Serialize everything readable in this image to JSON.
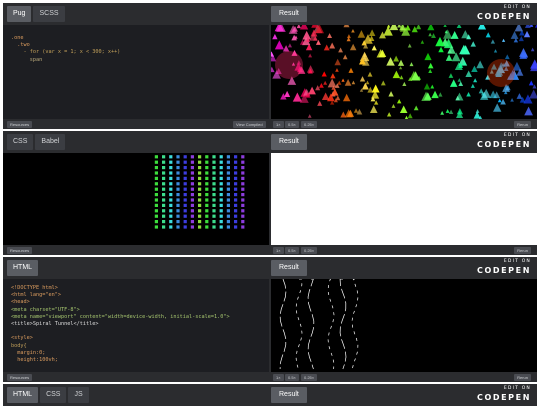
{
  "embeds": [
    {
      "left_tabs": [
        {
          "label": "Pug",
          "active": true
        },
        {
          "label": "SCSS",
          "active": false
        }
      ],
      "result_tab": "Result",
      "brand_small": "EDIT ON",
      "brand_big": "CODEPEN",
      "code_lines": [
        ".one",
        "  .two",
        "    - for (var x = 1; x < 300; x++)",
        "      span"
      ],
      "bottom": {
        "resources": "Resources",
        "view_compiled": "View Compiled",
        "zoom": [
          "1×",
          "0.5×",
          "0.25×"
        ],
        "rerun": "Rerun"
      }
    },
    {
      "left_tabs": [
        {
          "label": "CSS",
          "active": false
        },
        {
          "label": "Babel",
          "active": false
        }
      ],
      "result_tab": "Result",
      "brand_small": "EDIT ON",
      "brand_big": "CODEPEN",
      "bottom": {
        "resources": "Resources",
        "zoom": [
          "1×",
          "0.5×",
          "0.25×"
        ],
        "rerun": "Rerun"
      }
    },
    {
      "left_tabs": [
        {
          "label": "HTML",
          "active": true
        }
      ],
      "result_tab": "Result",
      "brand_small": "EDIT ON",
      "brand_big": "CODEPEN",
      "code_lines": [
        "<!DOCTYPE html>",
        "<html lang=\"en\">",
        "<head>",
        "<meta charset=\"UTF-8\">",
        "<meta name=\"viewport\" content=\"width=device-width, initial-scale=1.0\">",
        "<title>Spiral Tunnel</title>",
        "",
        "<style>",
        "body{",
        "  margin:0;",
        "  height:100vh;"
      ],
      "bottom": {
        "resources": "Resources",
        "zoom": [
          "1×",
          "0.5×",
          "0.25×"
        ],
        "rerun": "Rerun"
      }
    },
    {
      "left_tabs": [
        {
          "label": "HTML",
          "active": true
        },
        {
          "label": "CSS",
          "active": false
        },
        {
          "label": "JS",
          "active": false
        }
      ],
      "result_tab": "Result",
      "brand_small": "EDIT ON",
      "brand_big": "CODEPEN"
    }
  ]
}
